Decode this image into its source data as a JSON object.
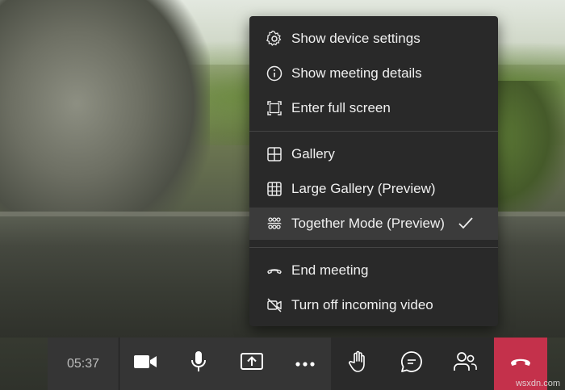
{
  "menu": {
    "items": [
      {
        "label": "Show device settings",
        "icon": "gear-icon"
      },
      {
        "label": "Show meeting details",
        "icon": "info-icon"
      },
      {
        "label": "Enter full screen",
        "icon": "fullscreen-icon"
      },
      {
        "label": "Gallery",
        "icon": "gallery-icon"
      },
      {
        "label": "Large Gallery (Preview)",
        "icon": "large-gallery-icon"
      },
      {
        "label": "Together Mode (Preview)",
        "icon": "together-mode-icon",
        "selected": true
      },
      {
        "label": "End meeting",
        "icon": "end-call-icon"
      },
      {
        "label": "Turn off incoming video",
        "icon": "video-off-icon"
      }
    ]
  },
  "toolbar": {
    "timer": "05:37",
    "buttons": [
      "camera-icon",
      "microphone-icon",
      "share-screen-icon",
      "more-options-icon",
      "raise-hand-icon",
      "chat-icon",
      "participants-icon",
      "hang-up-icon"
    ]
  },
  "colors": {
    "hangup": "#c4314b",
    "menu_bg": "#292929"
  },
  "watermark": "wsxdn.com"
}
